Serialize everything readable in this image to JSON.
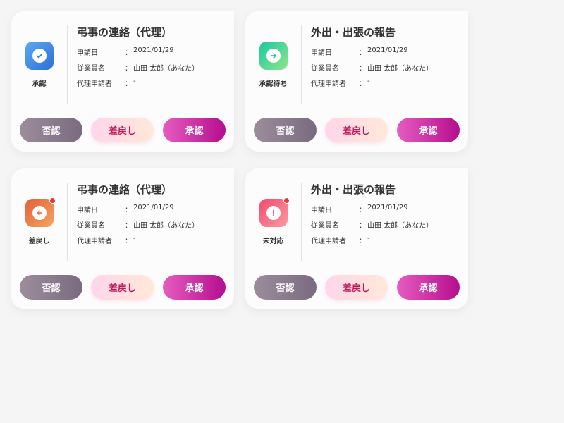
{
  "labels": {
    "date_key": "申請日",
    "employee_key": "従業員名",
    "proxy_key": "代理申請者",
    "colon": "："
  },
  "buttons": {
    "reject": "否認",
    "return": "差戻し",
    "approve": "承認"
  },
  "cards": [
    {
      "title": "弔事の連絡（代理）",
      "status": "承認",
      "status_icon": "check-icon",
      "status_color": "#3b82e0",
      "date": "2021/01/29",
      "employee": "山田 太郎（あなた）",
      "proxy": "-"
    },
    {
      "title": "外出・出張の報告",
      "status": "承認待ち",
      "status_icon": "arrow-right-icon",
      "status_color": "#2ecf9a",
      "date": "2021/01/29",
      "employee": "山田 太郎（あなた）",
      "proxy": "-"
    },
    {
      "title": "弔事の連絡（代理）",
      "status": "差戻し",
      "status_icon": "arrow-left-icon",
      "status_color": "#f07b4a",
      "date": "2021/01/29",
      "employee": "山田 太郎（あなた）",
      "proxy": "-"
    },
    {
      "title": "外出・出張の報告",
      "status": "未対応",
      "status_icon": "exclamation-icon",
      "status_color": "#f4607a",
      "date": "2021/01/29",
      "employee": "山田 太郎（あなた）",
      "proxy": "-"
    }
  ]
}
